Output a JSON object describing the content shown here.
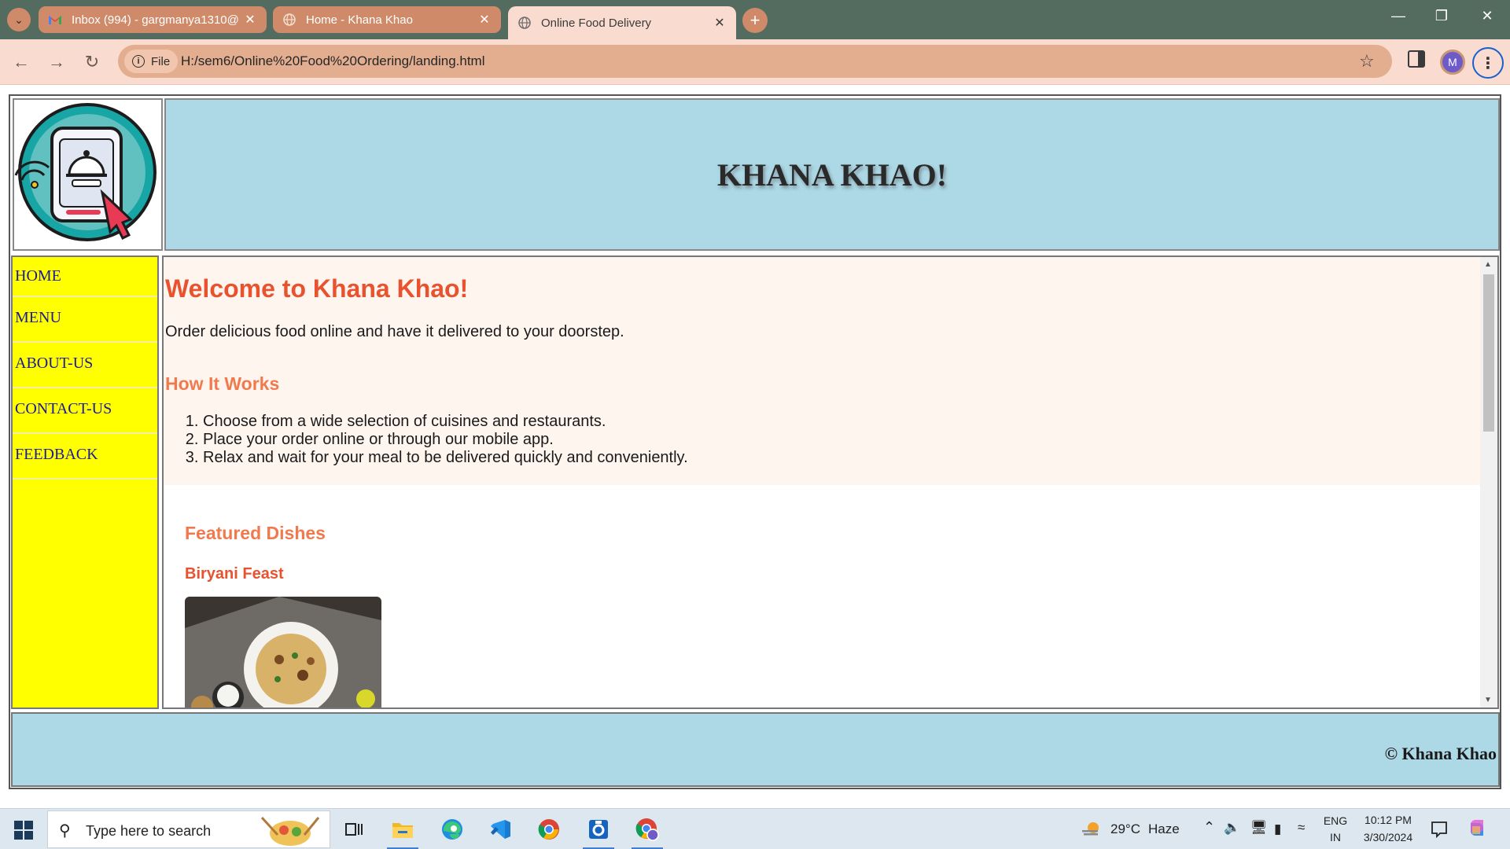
{
  "browser": {
    "tabs": [
      {
        "title": "Inbox (994) - gargmanya1310@",
        "favicon": "gmail-icon",
        "active": false
      },
      {
        "title": "Home - Khana Khao",
        "favicon": "globe-icon",
        "active": false
      },
      {
        "title": "Online Food Delivery",
        "favicon": "globe-icon",
        "active": true
      }
    ],
    "address": {
      "chip_label": "File",
      "url": "H:/sem6/Online%20Food%20Ordering/landing.html"
    },
    "profile_initial": "M"
  },
  "page": {
    "site_title": "KHANA KHAO!",
    "nav": [
      "HOME",
      "MENU",
      "ABOUT-US",
      "CONTACT-US",
      "FEEDBACK"
    ],
    "welcome_heading": "Welcome to Khana Khao!",
    "intro_text": "Order delicious food online and have it delivered to your doorstep.",
    "how_heading": "How It Works",
    "steps": [
      "Choose from a wide selection of cuisines and restaurants.",
      "Place your order online or through our mobile app.",
      "Relax and wait for your meal to be delivered quickly and conveniently."
    ],
    "featured_heading": "Featured Dishes",
    "dish_name": "Biryani Feast",
    "footer": "© Khana Khao",
    "colors": {
      "header_bg": "#add8e6",
      "nav_bg": "#ffff00",
      "heading_accent": "#e9522e",
      "subheading_accent": "#f07a4e",
      "intro_bg": "#fff5ef"
    }
  },
  "taskbar": {
    "search_placeholder": "Type here to search",
    "weather": {
      "temp": "29°C",
      "condition": "Haze"
    },
    "language": {
      "line1": "ENG",
      "line2": "IN"
    },
    "time": "10:12 PM",
    "date": "3/30/2024",
    "apps": [
      "task-view-icon",
      "file-explorer-icon",
      "edge-icon",
      "vscode-icon",
      "chrome-icon",
      "outlook-icon",
      "chrome-profile-icon"
    ]
  }
}
